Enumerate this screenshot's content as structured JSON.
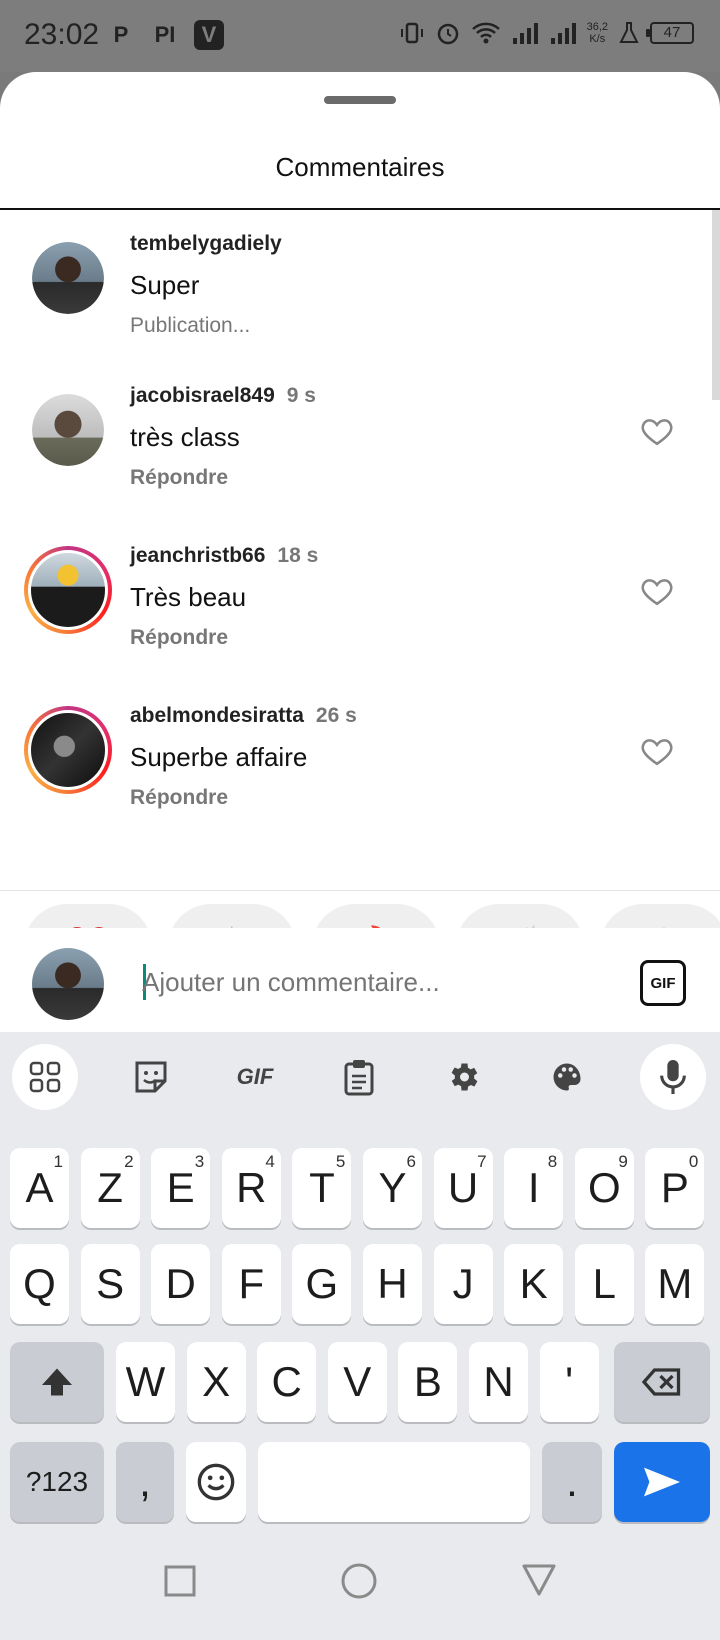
{
  "status_bar": {
    "time": "23:02",
    "app_icons": [
      "P",
      "PI",
      "V"
    ],
    "net_speed_value": "36,2",
    "net_speed_unit": "K/s",
    "battery": "47"
  },
  "sheet": {
    "title": "Commentaires"
  },
  "comments": [
    {
      "user": "tembelygadiely",
      "time": "",
      "text": "Super",
      "sub": "Publication...",
      "liked": false,
      "ring": false
    },
    {
      "user": "jacobisrael849",
      "time": "9 s",
      "text": "très class",
      "sub": "Répondre",
      "ring": false
    },
    {
      "user": "jeanchristb66",
      "time": "18 s",
      "text": "Très beau",
      "sub": "Répondre",
      "ring": true
    },
    {
      "user": "abelmondesiratta",
      "time": "26 s",
      "text": "Superbe affaire",
      "sub": "Répondre",
      "ring": true
    }
  ],
  "reactions": [
    "❤️",
    "🙌",
    "🔥",
    "👏",
    "😢"
  ],
  "compose": {
    "placeholder": "Ajouter un commentaire...",
    "gif_label": "GIF"
  },
  "keyboard": {
    "tools": [
      "apps-grid-icon",
      "sticker-icon",
      "gif-icon",
      "clipboard-icon",
      "settings-icon",
      "palette-icon",
      "microphone-icon"
    ],
    "tool_gif_label": "GIF",
    "row1": [
      [
        "A",
        "1"
      ],
      [
        "Z",
        "2"
      ],
      [
        "E",
        "3"
      ],
      [
        "R",
        "4"
      ],
      [
        "T",
        "5"
      ],
      [
        "Y",
        "6"
      ],
      [
        "U",
        "7"
      ],
      [
        "I",
        "8"
      ],
      [
        "O",
        "9"
      ],
      [
        "P",
        "0"
      ]
    ],
    "row2": [
      "Q",
      "S",
      "D",
      "F",
      "G",
      "H",
      "J",
      "K",
      "L",
      "M"
    ],
    "row3": [
      "W",
      "X",
      "C",
      "V",
      "B",
      "N",
      "'"
    ],
    "row4": {
      "symbols": "?123",
      "comma": ",",
      "period": "."
    }
  },
  "colors": {
    "accent_send": "#1a73e8",
    "caret": "#0b8a7a",
    "story_ring": [
      "#c13584",
      "#fd1d1d",
      "#fcaf45"
    ]
  }
}
